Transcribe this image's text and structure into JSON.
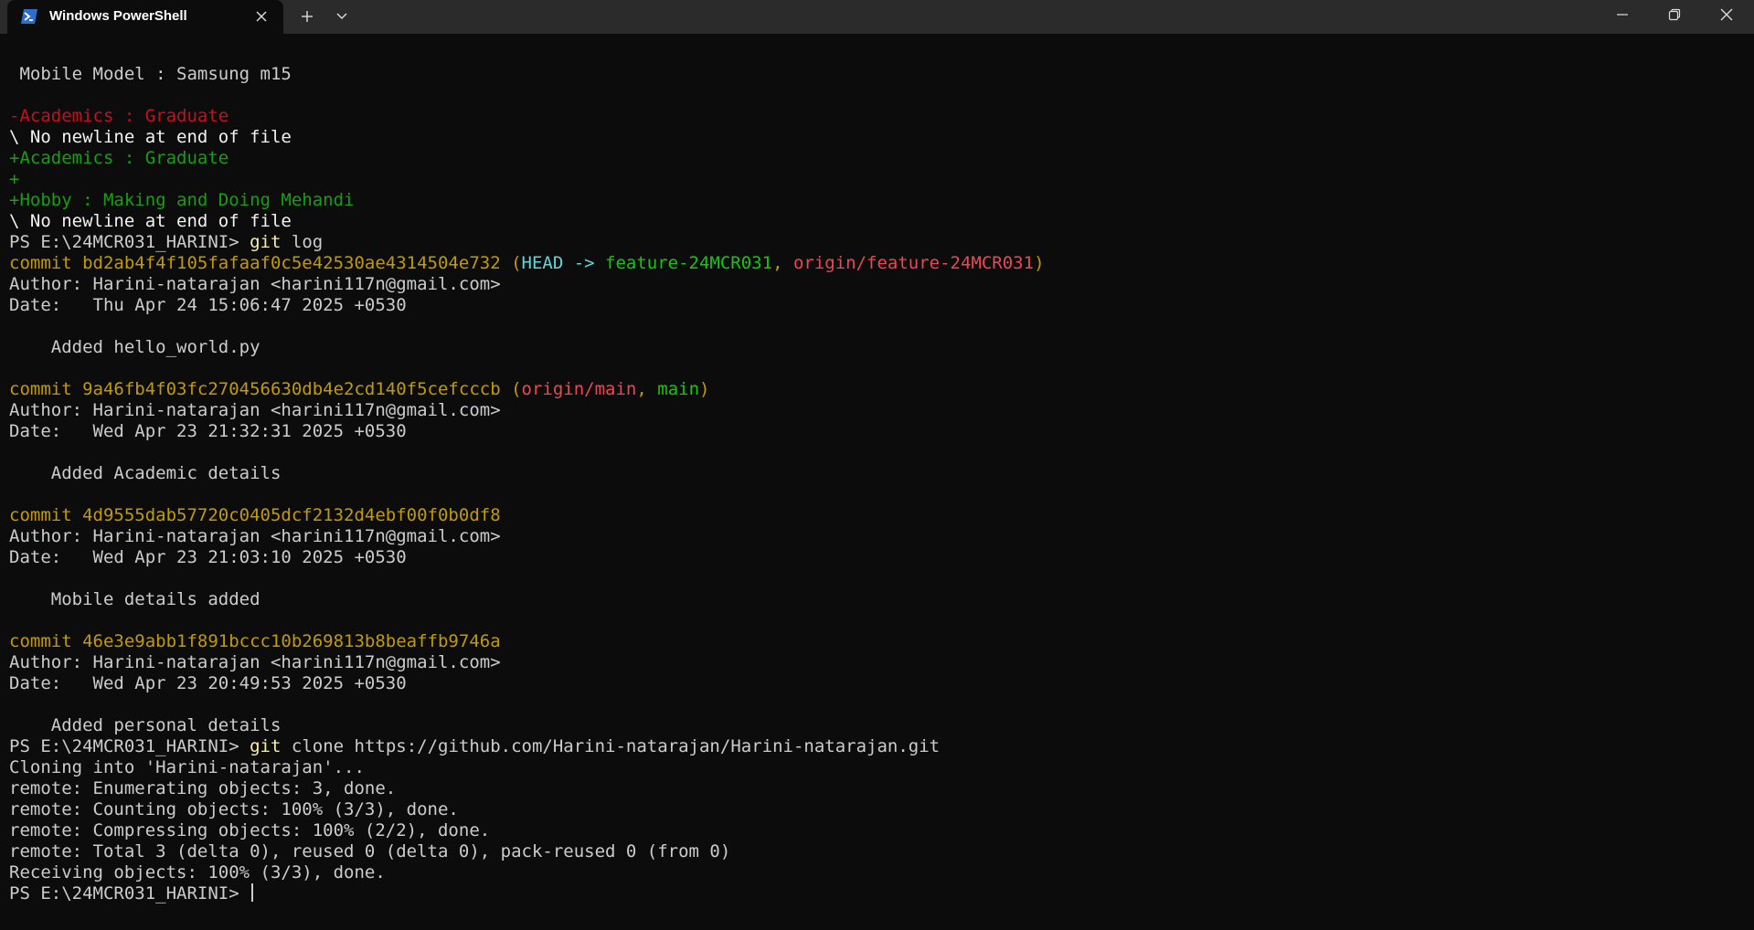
{
  "window": {
    "tab_title": "Windows PowerShell",
    "tab_icon": "powershell-icon",
    "buttons": {
      "new_tab": "plus-icon",
      "dropdown": "chevron-down-icon",
      "minimize": "minimize-icon",
      "maximize": "restore-icon",
      "close": "close-icon"
    }
  },
  "colors": {
    "background": "#0c0c0c",
    "titlebar": "#2b2b2b",
    "default_text": "#cccccc",
    "commit_yellow": "#c19c00",
    "diff_removed": "#c50f1f",
    "diff_added": "#13a10e",
    "head_cyan": "#61d6d6",
    "branch_green": "#16c60c",
    "remote_red": "#e74856",
    "command_yellow": "#f9f1a5"
  },
  "terminal": {
    "lines": [
      {
        "segments": [
          {
            "text": " Mobile Model : Samsung m15",
            "color": "default"
          }
        ]
      },
      {
        "segments": [
          {
            "text": "",
            "color": "default"
          }
        ]
      },
      {
        "segments": [
          {
            "text": "-Academics : Graduate",
            "color": "diff_removed"
          }
        ]
      },
      {
        "segments": [
          {
            "text": "\\ No newline at end of file",
            "color": "white"
          }
        ]
      },
      {
        "segments": [
          {
            "text": "+Academics : Graduate",
            "color": "diff_added"
          }
        ]
      },
      {
        "segments": [
          {
            "text": "+",
            "color": "diff_added"
          }
        ]
      },
      {
        "segments": [
          {
            "text": "+Hobby : Making and Doing Mehandi",
            "color": "diff_added"
          }
        ]
      },
      {
        "segments": [
          {
            "text": "\\ No newline at end of file",
            "color": "white"
          }
        ]
      },
      {
        "segments": [
          {
            "text": "PS E:\\24MCR031_HARINI> ",
            "color": "default"
          },
          {
            "text": "git",
            "color": "command"
          },
          {
            "text": " log",
            "color": "default"
          }
        ]
      },
      {
        "segments": [
          {
            "text": "commit bd2ab4f4f105fafaaf0c5e42530ae4314504e732 (",
            "color": "commit"
          },
          {
            "text": "HEAD -> ",
            "color": "head"
          },
          {
            "text": "feature-24MCR031",
            "color": "branch"
          },
          {
            "text": ", ",
            "color": "commit"
          },
          {
            "text": "origin/feature-24MCR031",
            "color": "remote"
          },
          {
            "text": ")",
            "color": "commit"
          }
        ]
      },
      {
        "segments": [
          {
            "text": "Author: Harini-natarajan <harini117n@gmail.com>",
            "color": "default"
          }
        ]
      },
      {
        "segments": [
          {
            "text": "Date:   Thu Apr 24 15:06:47 2025 +0530",
            "color": "default"
          }
        ]
      },
      {
        "segments": [
          {
            "text": "",
            "color": "default"
          }
        ]
      },
      {
        "segments": [
          {
            "text": "    Added hello_world.py",
            "color": "default"
          }
        ]
      },
      {
        "segments": [
          {
            "text": "",
            "color": "default"
          }
        ]
      },
      {
        "segments": [
          {
            "text": "commit 9a46fb4f03fc270456630db4e2cd140f5cefcccb (",
            "color": "commit"
          },
          {
            "text": "origin/main",
            "color": "remote"
          },
          {
            "text": ", ",
            "color": "commit"
          },
          {
            "text": "main",
            "color": "branch"
          },
          {
            "text": ")",
            "color": "commit"
          }
        ]
      },
      {
        "segments": [
          {
            "text": "Author: Harini-natarajan <harini117n@gmail.com>",
            "color": "default"
          }
        ]
      },
      {
        "segments": [
          {
            "text": "Date:   Wed Apr 23 21:32:31 2025 +0530",
            "color": "default"
          }
        ]
      },
      {
        "segments": [
          {
            "text": "",
            "color": "default"
          }
        ]
      },
      {
        "segments": [
          {
            "text": "    Added Academic details",
            "color": "default"
          }
        ]
      },
      {
        "segments": [
          {
            "text": "",
            "color": "default"
          }
        ]
      },
      {
        "segments": [
          {
            "text": "commit 4d9555dab57720c0405dcf2132d4ebf00f0b0df8",
            "color": "commit"
          }
        ]
      },
      {
        "segments": [
          {
            "text": "Author: Harini-natarajan <harini117n@gmail.com>",
            "color": "default"
          }
        ]
      },
      {
        "segments": [
          {
            "text": "Date:   Wed Apr 23 21:03:10 2025 +0530",
            "color": "default"
          }
        ]
      },
      {
        "segments": [
          {
            "text": "",
            "color": "default"
          }
        ]
      },
      {
        "segments": [
          {
            "text": "    Mobile details added",
            "color": "default"
          }
        ]
      },
      {
        "segments": [
          {
            "text": "",
            "color": "default"
          }
        ]
      },
      {
        "segments": [
          {
            "text": "commit 46e3e9abb1f891bccc10b269813b8beaffb9746a",
            "color": "commit"
          }
        ]
      },
      {
        "segments": [
          {
            "text": "Author: Harini-natarajan <harini117n@gmail.com>",
            "color": "default"
          }
        ]
      },
      {
        "segments": [
          {
            "text": "Date:   Wed Apr 23 20:49:53 2025 +0530",
            "color": "default"
          }
        ]
      },
      {
        "segments": [
          {
            "text": "",
            "color": "default"
          }
        ]
      },
      {
        "segments": [
          {
            "text": "    Added personal details",
            "color": "default"
          }
        ]
      },
      {
        "segments": [
          {
            "text": "PS E:\\24MCR031_HARINI> ",
            "color": "default"
          },
          {
            "text": "git",
            "color": "command"
          },
          {
            "text": " clone https://github.com/Harini-natarajan/Harini-natarajan.git",
            "color": "default"
          }
        ]
      },
      {
        "segments": [
          {
            "text": "Cloning into 'Harini-natarajan'...",
            "color": "default"
          }
        ]
      },
      {
        "segments": [
          {
            "text": "remote: Enumerating objects: 3, done.",
            "color": "default"
          }
        ]
      },
      {
        "segments": [
          {
            "text": "remote: Counting objects: 100% (3/3), done.",
            "color": "default"
          }
        ]
      },
      {
        "segments": [
          {
            "text": "remote: Compressing objects: 100% (2/2), done.",
            "color": "default"
          }
        ]
      },
      {
        "segments": [
          {
            "text": "remote: Total 3 (delta 0), reused 0 (delta 0), pack-reused 0 (from 0)",
            "color": "default"
          }
        ]
      },
      {
        "segments": [
          {
            "text": "Receiving objects: 100% (3/3), done.",
            "color": "default"
          }
        ]
      }
    ],
    "prompt": "PS E:\\24MCR031_HARINI> "
  }
}
